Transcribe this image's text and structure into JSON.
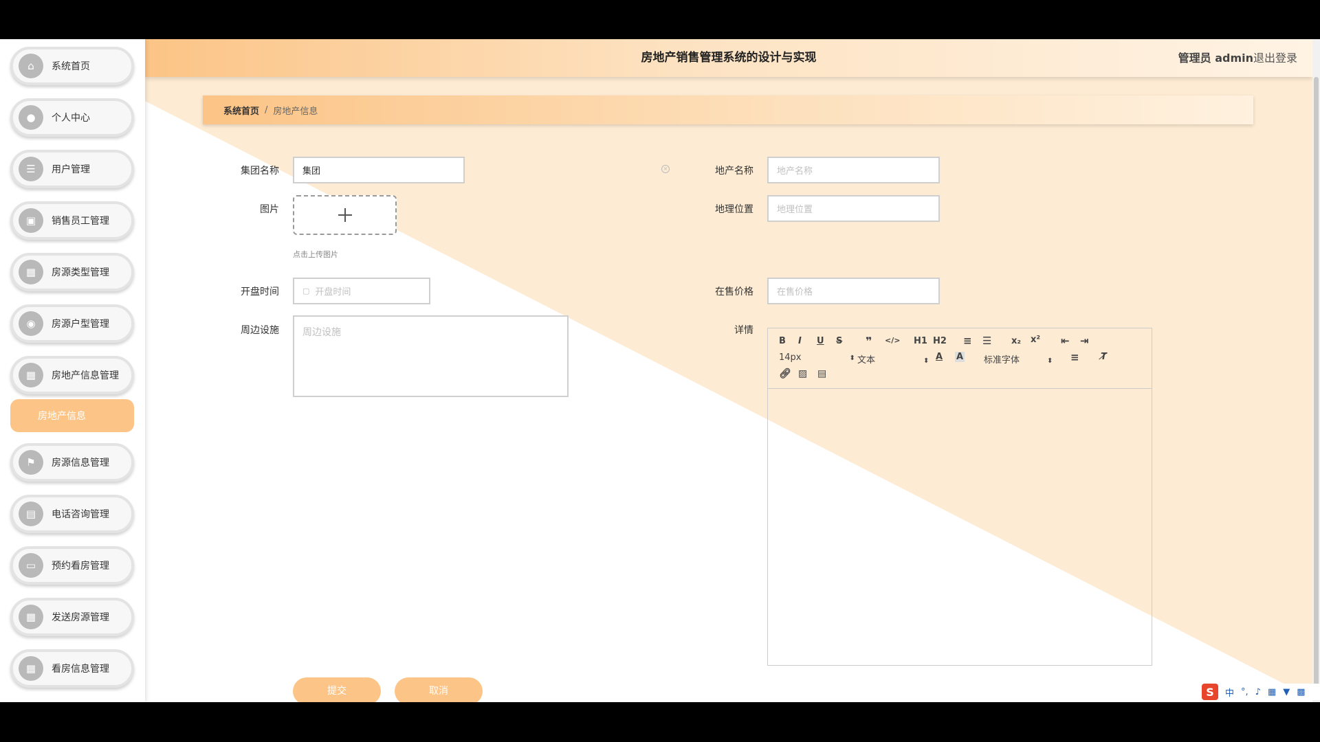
{
  "header": {
    "title": "房地产销售管理系统的设计与实现",
    "user": "管理员 admin",
    "logout": "退出登录"
  },
  "sidebar": {
    "items": [
      {
        "label": "系统首页",
        "icon": "home-icon"
      },
      {
        "label": "个人中心",
        "icon": "user-icon"
      },
      {
        "label": "用户管理",
        "icon": "list-icon"
      },
      {
        "label": "销售员工管理",
        "icon": "briefcase-icon"
      },
      {
        "label": "房源类型管理",
        "icon": "grid-icon"
      },
      {
        "label": "房源户型管理",
        "icon": "pin-icon"
      },
      {
        "label": "房地产信息管理",
        "icon": "grid-icon"
      },
      {
        "label": "房源信息管理",
        "icon": "flag-icon"
      },
      {
        "label": "电话咨询管理",
        "icon": "board-icon"
      },
      {
        "label": "预约看房管理",
        "icon": "monitor-icon"
      },
      {
        "label": "发送房源管理",
        "icon": "grid-icon"
      },
      {
        "label": "看房信息管理",
        "icon": "grid-icon"
      }
    ],
    "active_sub": "房地产信息"
  },
  "breadcrumb": {
    "home": "系统首页",
    "separator": "/",
    "current": "房地产信息"
  },
  "form": {
    "group_name_label": "集团名称",
    "group_name_value": "集团",
    "estate_name_label": "地产名称",
    "estate_name_placeholder": "地产名称",
    "image_label": "图片",
    "upload_hint": "点击上传图片",
    "location_label": "地理位置",
    "location_placeholder": "地理位置",
    "open_time_label": "开盘时间",
    "open_time_placeholder": "开盘时间",
    "price_label": "在售价格",
    "price_placeholder": "在售价格",
    "facilities_label": "周边设施",
    "facilities_placeholder": "周边设施",
    "detail_label": "详情"
  },
  "editor": {
    "font_size": "14px",
    "heading": "文本",
    "font_family": "标准字体",
    "h1": "H1",
    "h2": "H2"
  },
  "buttons": {
    "submit": "提交",
    "cancel": "取消"
  },
  "ime": {
    "lang": "中",
    "punct": "°,"
  },
  "colors": {
    "accent": "#fcc587",
    "background_triangle": "#fdebd3"
  }
}
